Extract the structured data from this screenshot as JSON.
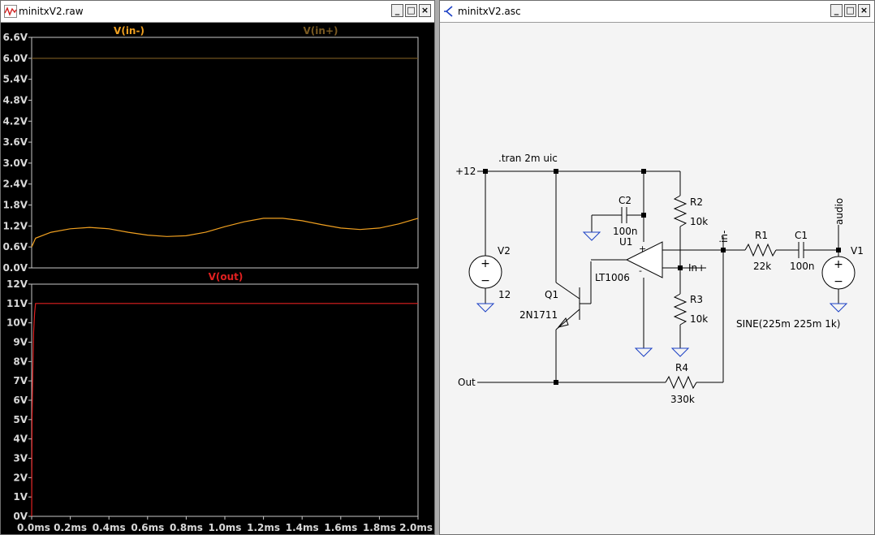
{
  "waveform_window": {
    "title": "minitxV2.raw",
    "buttons": {
      "minimize": "_",
      "maximize": "□",
      "close": "×"
    },
    "pane1": {
      "traces": [
        {
          "name": "V(in-)",
          "color": "#f0a020"
        },
        {
          "name": "V(in+)",
          "color": "#7a5a22"
        }
      ],
      "y_ticks": [
        "6.6V",
        "6.0V",
        "5.4V",
        "4.8V",
        "4.2V",
        "3.6V",
        "3.0V",
        "2.4V",
        "1.8V",
        "1.2V",
        "0.6V",
        "0.0V"
      ]
    },
    "pane2": {
      "traces": [
        {
          "name": "V(out)",
          "color": "#e02020"
        }
      ],
      "y_ticks": [
        "12V",
        "11V",
        "10V",
        "9V",
        "8V",
        "7V",
        "6V",
        "5V",
        "4V",
        "3V",
        "2V",
        "1V",
        "0V"
      ]
    },
    "x_ticks": [
      "0.0ms",
      "0.2ms",
      "0.4ms",
      "0.6ms",
      "0.8ms",
      "1.0ms",
      "1.2ms",
      "1.4ms",
      "1.6ms",
      "1.8ms",
      "2.0ms"
    ]
  },
  "chart_data": [
    {
      "type": "line",
      "x_unit": "ms",
      "y_unit": "V",
      "ylim": [
        0,
        6.6
      ],
      "xlim": [
        0,
        2.0
      ],
      "series": [
        {
          "name": "V(in+)",
          "x": [
            0,
            2.0
          ],
          "y": [
            6.0,
            6.0
          ]
        },
        {
          "name": "V(in-)",
          "x": [
            0.0,
            0.02,
            0.1,
            0.2,
            0.3,
            0.4,
            0.5,
            0.6,
            0.7,
            0.8,
            0.9,
            1.0,
            1.1,
            1.2,
            1.3,
            1.4,
            1.5,
            1.6,
            1.7,
            1.8,
            1.9,
            2.0
          ],
          "y": [
            0.6,
            0.85,
            1.02,
            1.12,
            1.16,
            1.12,
            1.02,
            0.94,
            0.9,
            0.92,
            1.02,
            1.18,
            1.32,
            1.42,
            1.42,
            1.35,
            1.24,
            1.14,
            1.1,
            1.14,
            1.26,
            1.42
          ]
        }
      ]
    },
    {
      "type": "line",
      "x_unit": "ms",
      "y_unit": "V",
      "ylim": [
        0,
        12
      ],
      "xlim": [
        0,
        2.0
      ],
      "series": [
        {
          "name": "V(out)",
          "x": [
            0.0,
            0.002,
            0.004,
            0.006,
            0.01,
            0.015,
            0.02,
            0.04,
            2.0
          ],
          "y": [
            0.0,
            5.0,
            6.5,
            7.5,
            9.5,
            10.5,
            11.0,
            11.0,
            11.0
          ]
        }
      ]
    }
  ],
  "schematic_window": {
    "title": "minitxV2.asc",
    "buttons": {
      "minimize": "_",
      "maximize": "□",
      "close": "×"
    },
    "directive": ".tran 2m uic",
    "labels": {
      "supply_net": "+12",
      "out_net": "Out",
      "in_minus_net": "in-",
      "in_plus_net": "In+",
      "audio_net": "audio"
    },
    "components": {
      "V2": {
        "ref": "V2",
        "value": "12"
      },
      "V1": {
        "ref": "V1",
        "value": "SINE(225m 225m 1k)"
      },
      "C2": {
        "ref": "C2",
        "value": "100n"
      },
      "U1": {
        "ref": "U1",
        "value": "LT1006"
      },
      "Q1": {
        "ref": "Q1",
        "value": "2N1711"
      },
      "R2": {
        "ref": "R2",
        "value": "10k"
      },
      "R3": {
        "ref": "R3",
        "value": "10k"
      },
      "R1": {
        "ref": "R1",
        "value": "22k"
      },
      "C1": {
        "ref": "C1",
        "value": "100n"
      },
      "R4": {
        "ref": "R4",
        "value": "330k"
      }
    },
    "opamp_pins": {
      "plus": "+",
      "minus": "-"
    },
    "source_signs": {
      "plus": "+",
      "minus": "−"
    }
  }
}
